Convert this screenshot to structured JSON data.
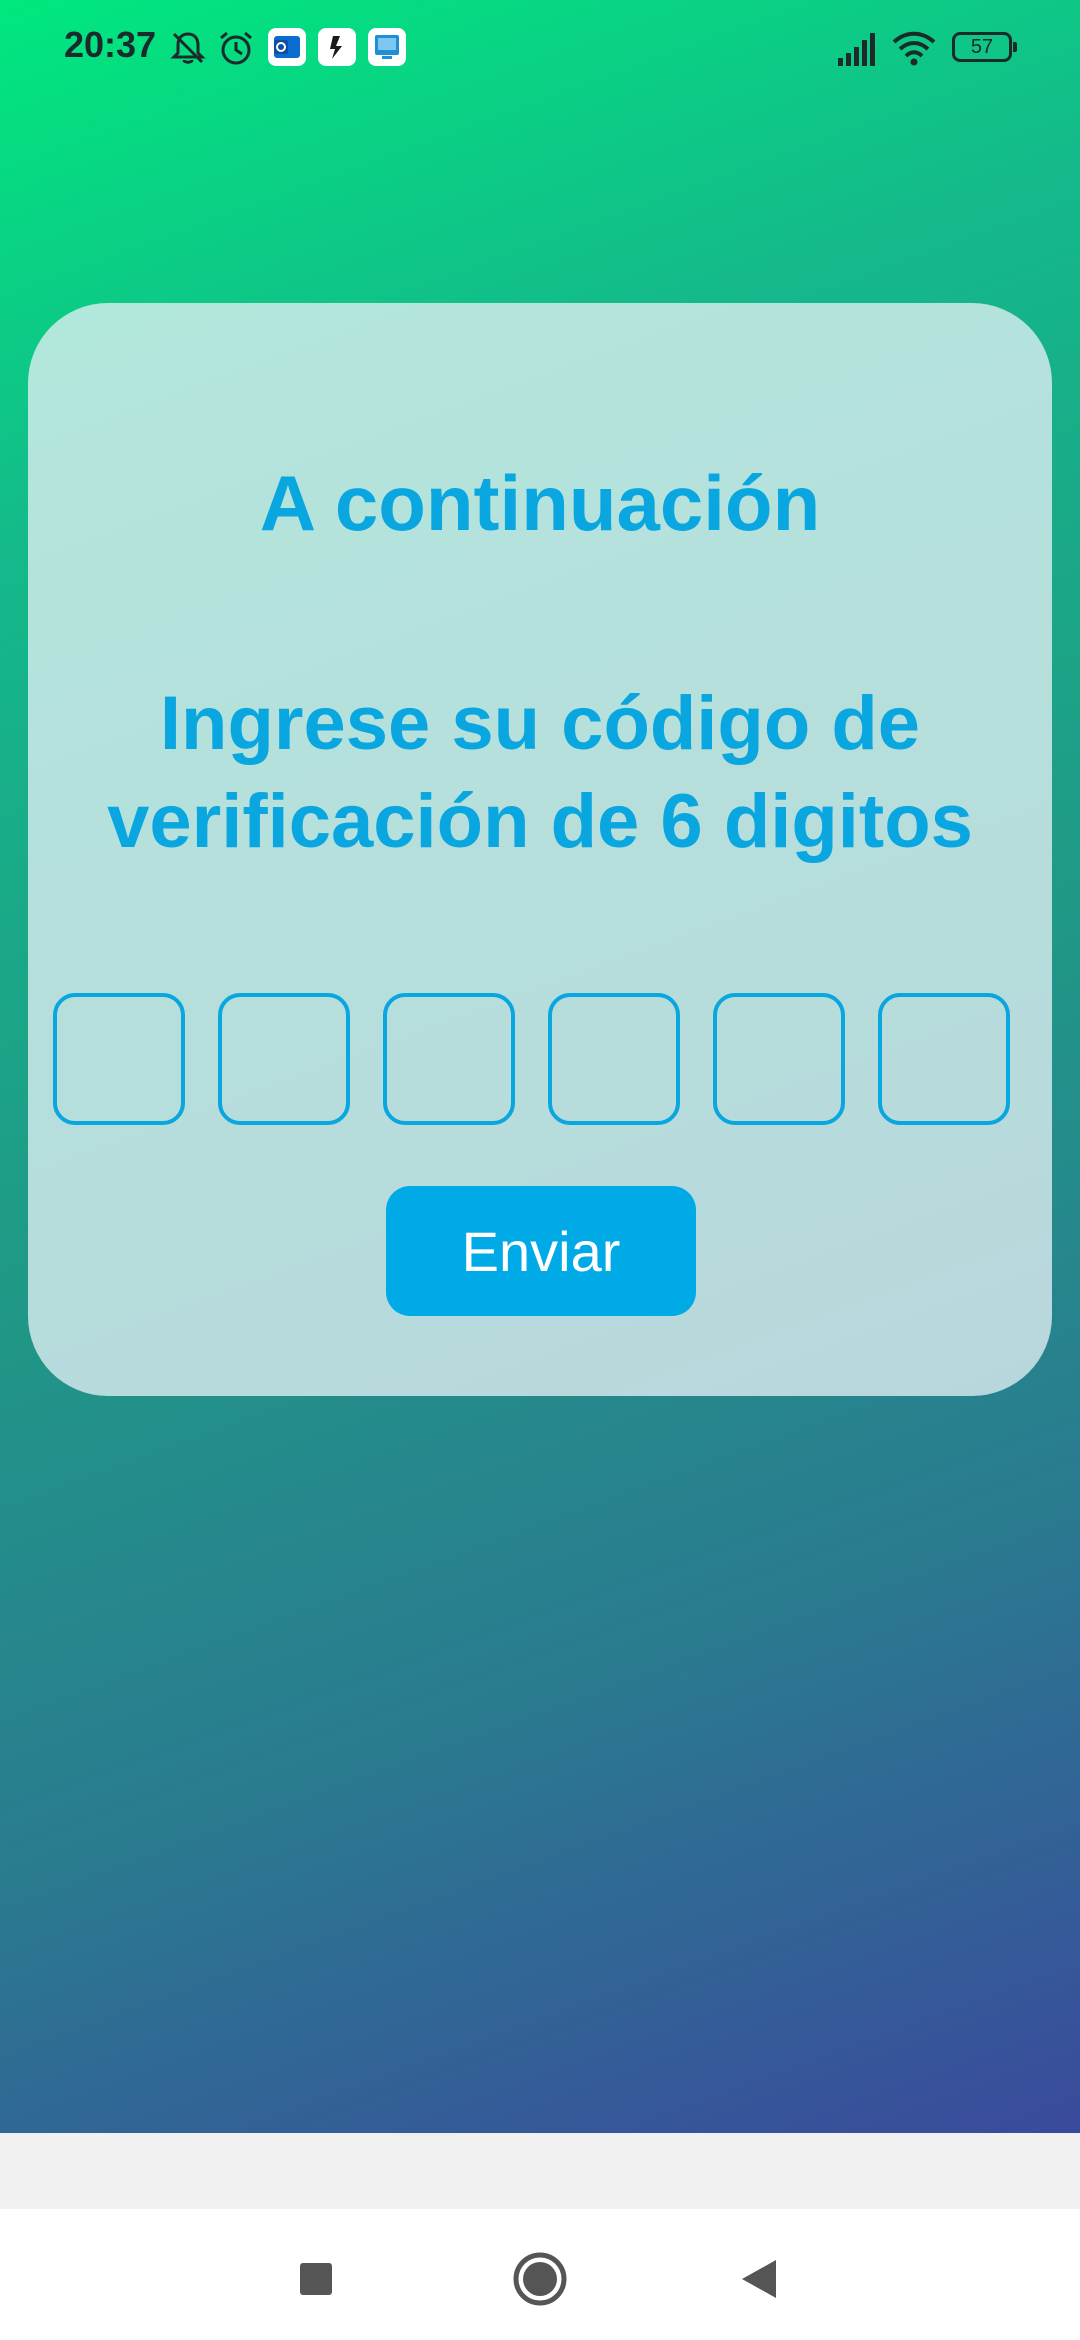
{
  "status_bar": {
    "time": "20:37",
    "battery": "57",
    "icons": [
      "bell-off-icon",
      "alarm-icon",
      "outlook-icon",
      "app-icon",
      "screen-app-icon",
      "signal-icon",
      "wifi-icon",
      "battery-icon"
    ]
  },
  "card": {
    "title": "A continuación",
    "subtitle": "Ingrese su código de verificación de 6 digitos",
    "code_digits": [
      "",
      "",
      "",
      "",
      "",
      ""
    ],
    "submit_label": "Enviar"
  },
  "nav": {
    "buttons": [
      "recents-square-icon",
      "home-circle-icon",
      "back-triangle-icon"
    ]
  },
  "colors": {
    "accent": "#09a6e0",
    "button": "#00aae6",
    "gradient_top": "#00e87e",
    "gradient_bottom": "#3a4a9c"
  }
}
